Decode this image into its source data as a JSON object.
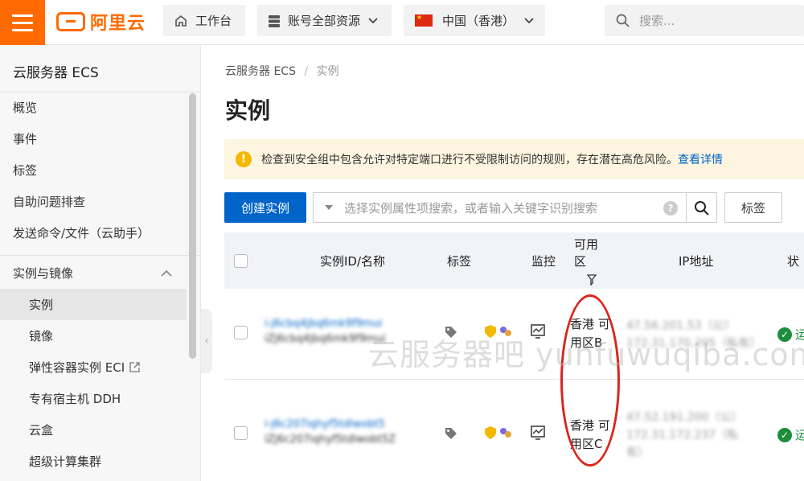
{
  "topbar": {
    "logo_text": "阿里云",
    "workbench_label": "工作台",
    "account_label": "账号全部资源",
    "region_label": "中国（香港）",
    "search_placeholder": "搜索..."
  },
  "sidebar": {
    "title": "云服务器 ECS",
    "items": [
      {
        "label": "概览"
      },
      {
        "label": "事件"
      },
      {
        "label": "标签"
      },
      {
        "label": "自助问题排查"
      },
      {
        "label": "发送命令/文件（云助手）"
      }
    ],
    "group_label": "实例与镜像",
    "group_items": [
      {
        "label": "实例"
      },
      {
        "label": "镜像"
      },
      {
        "label": "弹性容器实例 ECI"
      },
      {
        "label": "专有宿主机 DDH"
      },
      {
        "label": "云盒"
      },
      {
        "label": "超级计算集群"
      }
    ]
  },
  "main": {
    "breadcrumb_root": "云服务器 ECS",
    "breadcrumb_sep": "/",
    "breadcrumb_current": "实例",
    "title": "实例",
    "alert_text": "检查到安全组中包含允许对特定端口进行不受限制访问的规则，存在潜在高危风险。",
    "alert_link": "查看详情",
    "create_button": "创建实例",
    "search_placeholder": "选择实例属性项搜索，或者输入关键字识别搜索",
    "tag_button": "标签"
  },
  "table": {
    "headers": {
      "id_name": "实例ID/名称",
      "tags": "标签",
      "monitor": "监控",
      "zone": "可用区",
      "ip": "IP地址",
      "status_partial": "状"
    },
    "rows": [
      {
        "id": "i-j6cbq4jbq6mk9f9mui",
        "name": "iZj6cbq4jbq6mk9f9mui",
        "zone_line1": "香港 可",
        "zone_line2": "用区B",
        "ip_public": "47.56.201.53（公）",
        "ip_private": "172.31.170.205（私有）",
        "status": "运"
      },
      {
        "id": "i-j6c207iqhyf5tdlwobt5",
        "name": "iZj6c207iqhyf5tdlwobt5Z",
        "zone_line1": "香港 可",
        "zone_line2": "用区C",
        "ip_public": "47.52.191.200（公）",
        "ip_private": "172.31.172.237（私",
        "ip_private_2": "有）",
        "status": "运"
      }
    ]
  },
  "watermark": "云服务器吧 yunfuwuqiba.com",
  "colors": {
    "brand_orange": "#ff6a00",
    "primary_blue": "#0064c8",
    "alert_bg": "#fdf5e0",
    "annotation_red": "#d9261c",
    "status_green": "#1e8e3e"
  }
}
